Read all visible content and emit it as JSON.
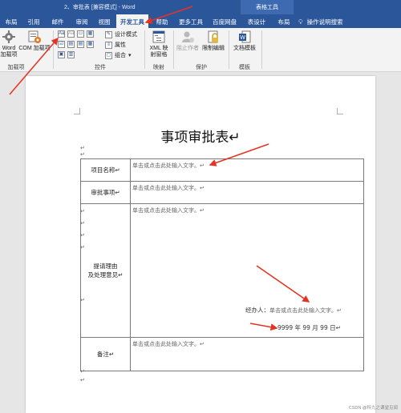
{
  "window": {
    "title": "2、审批表 [兼容模式] - Word",
    "context_tab_group": "表格工具"
  },
  "ribbon_tabs": [
    {
      "label": "布局"
    },
    {
      "label": "引用"
    },
    {
      "label": "邮件"
    },
    {
      "label": "审阅"
    },
    {
      "label": "视图"
    },
    {
      "label": "开发工具"
    },
    {
      "label": "帮助"
    },
    {
      "label": "更多工具"
    },
    {
      "label": "百度网盘"
    },
    {
      "label": "表设计"
    },
    {
      "label": "布局"
    },
    {
      "label": "操作说明搜索"
    }
  ],
  "ribbon": {
    "addins": {
      "word_addins": "Word\n加载项",
      "com_addins": "COM 加载项",
      "group_label": "加载项"
    },
    "controls": {
      "design_mode": "设计模式",
      "properties": "属性",
      "group": "组合",
      "group_label": "控件"
    },
    "mapping": {
      "xml_pane": "XML 映\n射窗格",
      "group_label": "映射"
    },
    "protect": {
      "block_authors": "阻止作者",
      "restrict_editing": "限制编辑",
      "group_label": "保护"
    },
    "templates": {
      "document_template": "文档模板",
      "group_label": "模板"
    }
  },
  "document": {
    "heading": "事项审批表↵",
    "para_mark": "↵",
    "rows": [
      {
        "label": "项目名称↵",
        "value": "单击或点击此处输入文字。↵"
      },
      {
        "label": "审批事项↵",
        "value": "单击或点击此处输入文字。↵"
      },
      {
        "label": "提请理由\n及处理意见↵",
        "value": "单击或点击此处输入文字。↵"
      },
      {
        "label": "备注↵",
        "value": "单击或点击此处输入文字。↵"
      }
    ],
    "handler_label": "经办人：",
    "handler_value": "单击或点击此处输入文字。↵",
    "date_text": "9999 年 99 月 99 日↵"
  },
  "watermark": "CSDN @科九之课堂见闻",
  "colors": {
    "titlebar": "#2b579a",
    "ribbon_bg": "#f3f3f3",
    "annotation_arrow": "#e53222"
  },
  "icons": [
    "gear-icon",
    "com-addin-icon",
    "design-mode-icon",
    "properties-icon",
    "group-icon",
    "xml-mapping-icon",
    "block-authors-icon",
    "lock-icon",
    "word-template-icon",
    "lightbulb-icon"
  ]
}
